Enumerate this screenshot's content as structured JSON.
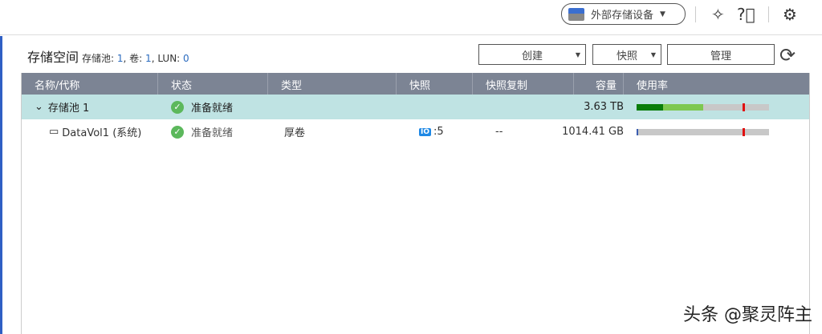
{
  "topbar": {
    "external_storage": "外部存储设备"
  },
  "header": {
    "title": "存储空间",
    "pools_label": "存储池:",
    "pools": "1",
    "volumes_label": "卷:",
    "volumes": "1",
    "lun_label": "LUN:",
    "lun": "0"
  },
  "toolbar": {
    "create": "创建",
    "snapshot": "快照",
    "manage": "管理"
  },
  "table": {
    "columns": [
      "名称/代称",
      "状态",
      "类型",
      "快照",
      "快照复制",
      "容量",
      "使用率"
    ],
    "rows": [
      {
        "name": "存储池 1",
        "status": "准备就绪",
        "type": "",
        "snapshot": "",
        "replication": "",
        "capacity": "3.63 TB",
        "usage_used_pct": 20,
        "usage_alloc_pct": 30,
        "threshold_pct": 80
      },
      {
        "name": "DataVol1 (系统)",
        "status": "准备就绪",
        "type": "厚卷",
        "snapshot": ":5",
        "replication": "--",
        "capacity": "1014.41 GB",
        "usage_used_pct": 1,
        "threshold_pct": 80
      }
    ]
  },
  "watermark": "头条 @聚灵阵主"
}
